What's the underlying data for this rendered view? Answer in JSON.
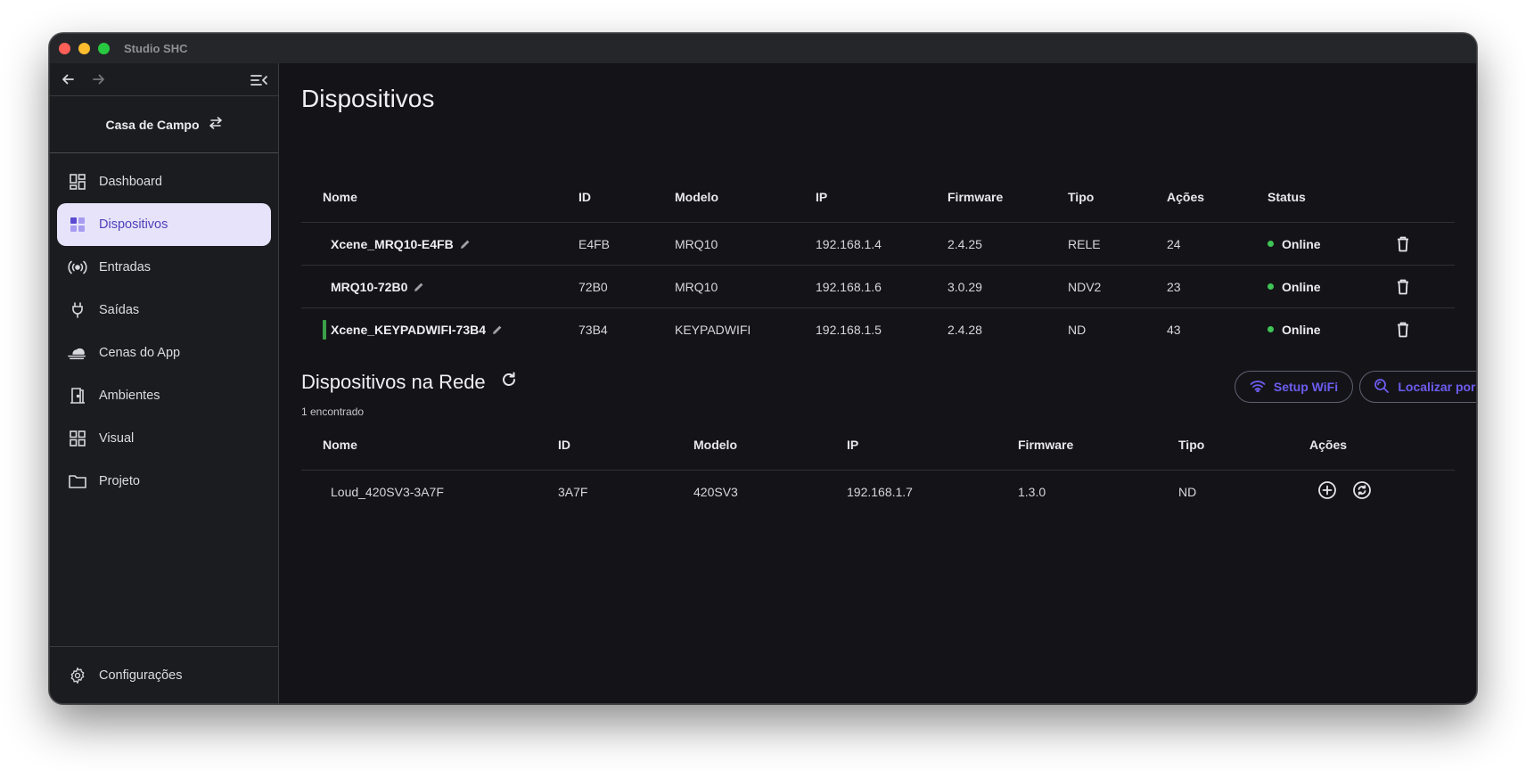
{
  "window": {
    "title": "Studio SHC"
  },
  "sidebar": {
    "project_name": "Casa de Campo",
    "items": [
      {
        "label": "Dashboard",
        "icon": "dashboard-icon",
        "active": false
      },
      {
        "label": "Dispositivos",
        "icon": "devices-icon",
        "active": true
      },
      {
        "label": "Entradas",
        "icon": "inputs-icon",
        "active": false
      },
      {
        "label": "Saídas",
        "icon": "plug-icon",
        "active": false
      },
      {
        "label": "Cenas do App",
        "icon": "scenes-icon",
        "active": false
      },
      {
        "label": "Ambientes",
        "icon": "rooms-icon",
        "active": false
      },
      {
        "label": "Visual",
        "icon": "visual-grid-icon",
        "active": false
      },
      {
        "label": "Projeto",
        "icon": "folder-icon",
        "active": false
      }
    ],
    "footer_label": "Configurações"
  },
  "main": {
    "title": "Dispositivos",
    "devices_table": {
      "headers": [
        "Nome",
        "ID",
        "Modelo",
        "IP",
        "Firmware",
        "Tipo",
        "Ações",
        "Status"
      ],
      "rows": [
        {
          "name": "Xcene_MRQ10-E4FB",
          "id": "E4FB",
          "model": "MRQ10",
          "ip": "192.168.1.4",
          "firmware": "2.4.25",
          "type": "RELE",
          "actions": "24",
          "status": "Online"
        },
        {
          "name": "MRQ10-72B0",
          "id": "72B0",
          "model": "MRQ10",
          "ip": "192.168.1.6",
          "firmware": "3.0.29",
          "type": "NDV2",
          "actions": "23",
          "status": "Online"
        },
        {
          "name": "Xcene_KEYPADWIFI-73B4",
          "id": "73B4",
          "model": "KEYPADWIFI",
          "ip": "192.168.1.5",
          "firmware": "2.4.28",
          "type": "ND",
          "actions": "43",
          "status": "Online"
        }
      ]
    },
    "network": {
      "title": "Dispositivos na Rede",
      "found_count": "1 encontrado",
      "setup_wifi_label": "Setup WiFi",
      "locate_ip_label": "Localizar por IP",
      "headers": [
        "Nome",
        "ID",
        "Modelo",
        "IP",
        "Firmware",
        "Tipo",
        "Ações"
      ],
      "rows": [
        {
          "name": "Loud_420SV3-3A7F",
          "id": "3A7F",
          "model": "420SV3",
          "ip": "192.168.1.7",
          "firmware": "1.3.0",
          "type": "ND"
        }
      ]
    }
  },
  "colors": {
    "accent": "#6c5cf0",
    "active_nav_bg": "#e7e3fb",
    "online": "#3fc455",
    "row_marker": "#3aa04a"
  }
}
